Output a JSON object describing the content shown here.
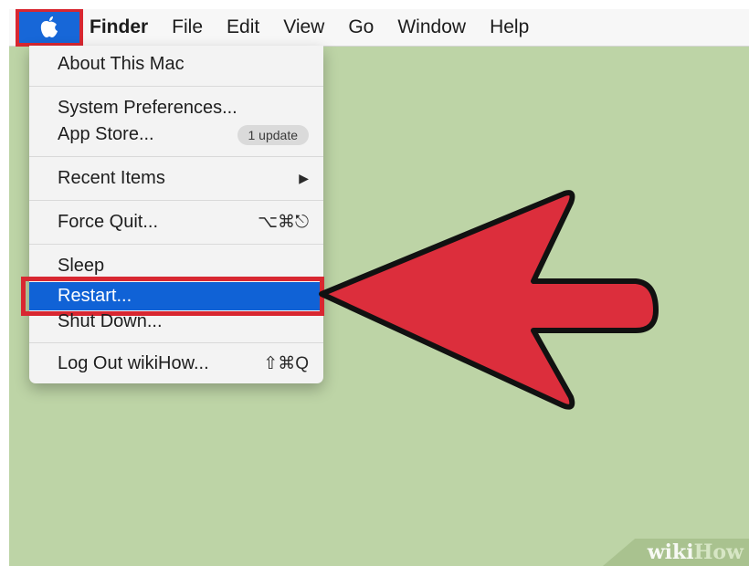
{
  "colors": {
    "desktop": "#bdd4a6",
    "highlight_border": "#d82731",
    "selection": "#1062d6",
    "arrow_fill": "#dc2e3c"
  },
  "menubar": {
    "apple_icon": "apple-icon",
    "items": [
      "Finder",
      "File",
      "Edit",
      "View",
      "Go",
      "Window",
      "Help"
    ]
  },
  "apple_menu": {
    "about": "About This Mac",
    "system_preferences": "System Preferences...",
    "app_store": "App Store...",
    "app_store_badge": "1 update",
    "recent_items": "Recent Items",
    "recent_items_arrow": "▶",
    "force_quit": "Force Quit...",
    "force_quit_shortcut": "⌥⌘⎋",
    "sleep": "Sleep",
    "restart": "Restart...",
    "shut_down": "Shut Down...",
    "log_out": "Log Out wikiHow...",
    "log_out_shortcut": "⇧⌘Q"
  },
  "watermark": {
    "part1": "wiki",
    "part2": "How"
  }
}
